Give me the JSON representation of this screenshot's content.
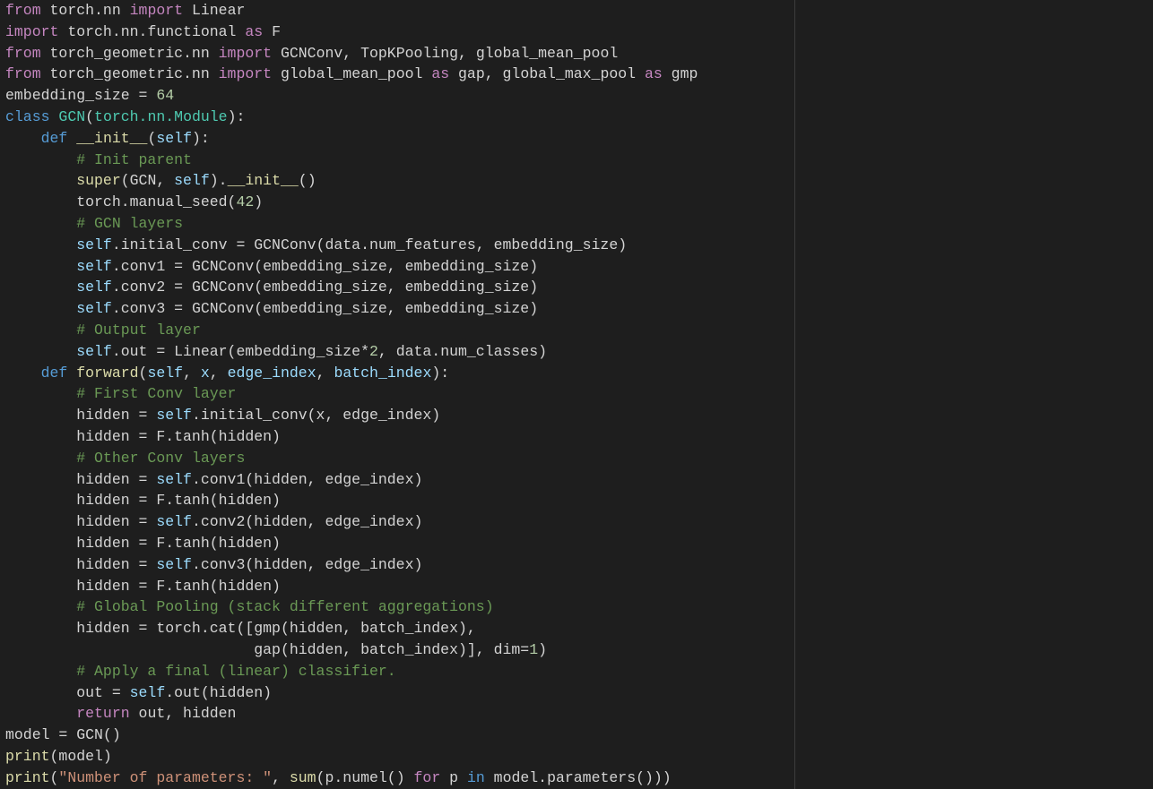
{
  "editor": {
    "colors": {
      "background": "#1e1e1e",
      "default": "#d4d4d4",
      "keyword": "#c586c0",
      "storage": "#569cd6",
      "class": "#4ec9b0",
      "func": "#dcdcaa",
      "param": "#9cdcfe",
      "number": "#b5cea8",
      "comment": "#6a9955",
      "string": "#ce9178"
    },
    "lines": [
      [
        [
          "keyword",
          "from"
        ],
        [
          "default",
          " torch.nn "
        ],
        [
          "keyword",
          "import"
        ],
        [
          "default",
          " Linear"
        ]
      ],
      [
        [
          "keyword",
          "import"
        ],
        [
          "default",
          " torch.nn.functional "
        ],
        [
          "keyword",
          "as"
        ],
        [
          "default",
          " F"
        ]
      ],
      [
        [
          "keyword",
          "from"
        ],
        [
          "default",
          " torch_geometric.nn "
        ],
        [
          "keyword",
          "import"
        ],
        [
          "default",
          " GCNConv, TopKPooling, global_mean_pool"
        ]
      ],
      [
        [
          "keyword",
          "from"
        ],
        [
          "default",
          " torch_geometric.nn "
        ],
        [
          "keyword",
          "import"
        ],
        [
          "default",
          " global_mean_pool "
        ],
        [
          "keyword",
          "as"
        ],
        [
          "default",
          " gap, global_max_pool "
        ],
        [
          "keyword",
          "as"
        ],
        [
          "default",
          " gmp"
        ]
      ],
      [
        [
          "default",
          "embedding_size = "
        ],
        [
          "number",
          "64"
        ]
      ],
      [
        [
          "storage",
          "class"
        ],
        [
          "default",
          " "
        ],
        [
          "class",
          "GCN"
        ],
        [
          "default",
          "("
        ],
        [
          "class",
          "torch.nn.Module"
        ],
        [
          "default",
          "):"
        ]
      ],
      [
        [
          "default",
          "    "
        ],
        [
          "storage",
          "def"
        ],
        [
          "default",
          " "
        ],
        [
          "func",
          "__init__"
        ],
        [
          "default",
          "("
        ],
        [
          "param",
          "self"
        ],
        [
          "default",
          "):"
        ]
      ],
      [
        [
          "default",
          "        "
        ],
        [
          "comment",
          "# Init parent"
        ]
      ],
      [
        [
          "default",
          "        "
        ],
        [
          "func",
          "super"
        ],
        [
          "default",
          "(GCN, "
        ],
        [
          "param",
          "self"
        ],
        [
          "default",
          ")."
        ],
        [
          "func",
          "__init__"
        ],
        [
          "default",
          "()"
        ]
      ],
      [
        [
          "default",
          "        torch.manual_seed("
        ],
        [
          "number",
          "42"
        ],
        [
          "default",
          ")"
        ]
      ],
      [
        [
          "default",
          "        "
        ],
        [
          "comment",
          "# GCN layers"
        ]
      ],
      [
        [
          "default",
          "        "
        ],
        [
          "param",
          "self"
        ],
        [
          "default",
          ".initial_conv = GCNConv(data.num_features, embedding_size)"
        ]
      ],
      [
        [
          "default",
          "        "
        ],
        [
          "param",
          "self"
        ],
        [
          "default",
          ".conv1 = GCNConv(embedding_size, embedding_size)"
        ]
      ],
      [
        [
          "default",
          "        "
        ],
        [
          "param",
          "self"
        ],
        [
          "default",
          ".conv2 = GCNConv(embedding_size, embedding_size)"
        ]
      ],
      [
        [
          "default",
          "        "
        ],
        [
          "param",
          "self"
        ],
        [
          "default",
          ".conv3 = GCNConv(embedding_size, embedding_size)"
        ]
      ],
      [
        [
          "default",
          "        "
        ],
        [
          "comment",
          "# Output layer"
        ]
      ],
      [
        [
          "default",
          "        "
        ],
        [
          "param",
          "self"
        ],
        [
          "default",
          ".out = Linear(embedding_size*"
        ],
        [
          "number",
          "2"
        ],
        [
          "default",
          ", data.num_classes)"
        ]
      ],
      [
        [
          "default",
          "    "
        ],
        [
          "storage",
          "def"
        ],
        [
          "default",
          " "
        ],
        [
          "func",
          "forward"
        ],
        [
          "default",
          "("
        ],
        [
          "param",
          "self"
        ],
        [
          "default",
          ", "
        ],
        [
          "param",
          "x"
        ],
        [
          "default",
          ", "
        ],
        [
          "param",
          "edge_index"
        ],
        [
          "default",
          ", "
        ],
        [
          "param",
          "batch_index"
        ],
        [
          "default",
          "):"
        ]
      ],
      [
        [
          "default",
          "        "
        ],
        [
          "comment",
          "# First Conv layer"
        ]
      ],
      [
        [
          "default",
          "        hidden = "
        ],
        [
          "param",
          "self"
        ],
        [
          "default",
          ".initial_conv(x, edge_index)"
        ]
      ],
      [
        [
          "default",
          "        hidden = F.tanh(hidden)"
        ]
      ],
      [
        [
          "default",
          "        "
        ],
        [
          "comment",
          "# Other Conv layers"
        ]
      ],
      [
        [
          "default",
          "        hidden = "
        ],
        [
          "param",
          "self"
        ],
        [
          "default",
          ".conv1(hidden, edge_index)"
        ]
      ],
      [
        [
          "default",
          "        hidden = F.tanh(hidden)"
        ]
      ],
      [
        [
          "default",
          "        hidden = "
        ],
        [
          "param",
          "self"
        ],
        [
          "default",
          ".conv2(hidden, edge_index)"
        ]
      ],
      [
        [
          "default",
          "        hidden = F.tanh(hidden)"
        ]
      ],
      [
        [
          "default",
          "        hidden = "
        ],
        [
          "param",
          "self"
        ],
        [
          "default",
          ".conv3(hidden, edge_index)"
        ]
      ],
      [
        [
          "default",
          "        hidden = F.tanh(hidden)"
        ]
      ],
      [
        [
          "default",
          "        "
        ],
        [
          "comment",
          "# Global Pooling (stack different aggregations)"
        ]
      ],
      [
        [
          "default",
          "        hidden = torch.cat([gmp(hidden, batch_index),"
        ]
      ],
      [
        [
          "default",
          "                            gap(hidden, batch_index)], dim="
        ],
        [
          "number",
          "1"
        ],
        [
          "default",
          ")"
        ]
      ],
      [
        [
          "default",
          "        "
        ],
        [
          "comment",
          "# Apply a final (linear) classifier."
        ]
      ],
      [
        [
          "default",
          "        out = "
        ],
        [
          "param",
          "self"
        ],
        [
          "default",
          ".out(hidden)"
        ]
      ],
      [
        [
          "default",
          "        "
        ],
        [
          "keyword",
          "return"
        ],
        [
          "default",
          " out, hidden"
        ]
      ],
      [
        [
          "default",
          "model = GCN()"
        ]
      ],
      [
        [
          "func",
          "print"
        ],
        [
          "default",
          "(model)"
        ]
      ],
      [
        [
          "func",
          "print"
        ],
        [
          "default",
          "("
        ],
        [
          "string",
          "\"Number of parameters: \""
        ],
        [
          "default",
          ", "
        ],
        [
          "func",
          "sum"
        ],
        [
          "default",
          "(p.numel() "
        ],
        [
          "keyword",
          "for"
        ],
        [
          "default",
          " p "
        ],
        [
          "storage",
          "in"
        ],
        [
          "default",
          " model.parameters()))"
        ]
      ]
    ]
  }
}
